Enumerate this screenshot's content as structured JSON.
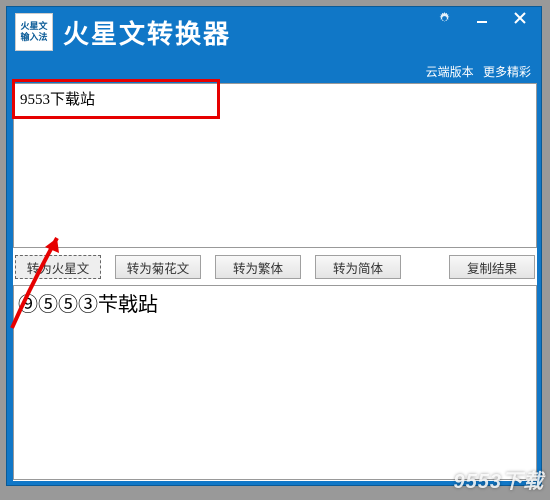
{
  "window": {
    "icon_line1": "火星文",
    "icon_line2": "输入法",
    "title": "火星文转换器"
  },
  "meta": {
    "link1": "云端版本",
    "link2": "更多精彩"
  },
  "input": {
    "value": "9553下载站"
  },
  "buttons": {
    "to_mars": "转为火星文",
    "to_juhua": "转为菊花文",
    "to_trad": "转为繁体",
    "to_simp": "转为简体",
    "copy": "复制结果"
  },
  "output": {
    "value": "⑨⑤⑤③芐戟跕"
  },
  "watermark": "9553下载"
}
